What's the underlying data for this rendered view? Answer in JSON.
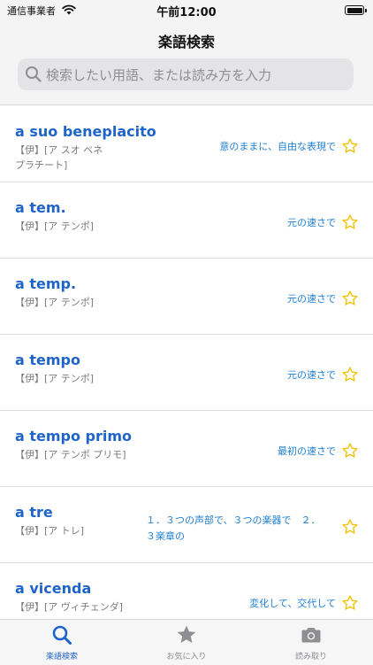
{
  "status_bar": {
    "carrier": "通信事業者",
    "time": "午前12:00"
  },
  "header": {
    "title": "楽語検索"
  },
  "search": {
    "placeholder": "検索したい用語、または読み方を入力"
  },
  "colors": {
    "accent": "#1f64c8",
    "meaning": "#1f7fd1",
    "star": "#f2c200"
  },
  "entries": [
    {
      "term": "a suo beneplacito",
      "lang": "【伊】",
      "reading_1": "[ア スオ ベネ",
      "reading_2": "プラチート]",
      "meaning_1": "意のままに、自由な表現で",
      "meaning_2": ""
    },
    {
      "term": "a tem.",
      "lang": "【伊】",
      "reading_1": "[ア テンポ]",
      "reading_2": "",
      "meaning_1": "元の速さで",
      "meaning_2": ""
    },
    {
      "term": "a temp.",
      "lang": "【伊】",
      "reading_1": "[ア テンポ]",
      "reading_2": "",
      "meaning_1": "元の速さで",
      "meaning_2": ""
    },
    {
      "term": "a tempo",
      "lang": "【伊】",
      "reading_1": "[ア テンポ]",
      "reading_2": "",
      "meaning_1": "元の速さで",
      "meaning_2": ""
    },
    {
      "term": "a tempo primo",
      "lang": "【伊】",
      "reading_1": "[ア テンポ プリモ]",
      "reading_2": "",
      "meaning_1": "最初の速さで",
      "meaning_2": ""
    },
    {
      "term": "a tre",
      "lang": "【伊】",
      "reading_1": "[ア トレ]",
      "reading_2": "",
      "meaning_1": "１．３つの声部で、３つの楽器で　２．",
      "meaning_2": "３楽章の"
    },
    {
      "term": "a vicenda",
      "lang": "【伊】",
      "reading_1": "[ア ヴィチェンダ]",
      "reading_2": "",
      "meaning_1": "変化して、交代して",
      "meaning_2": ""
    }
  ],
  "tabs": [
    {
      "label": "楽語検索",
      "icon": "search-icon"
    },
    {
      "label": "お気に入り",
      "icon": "star-icon"
    },
    {
      "label": "読み取り",
      "icon": "camera-icon"
    }
  ]
}
